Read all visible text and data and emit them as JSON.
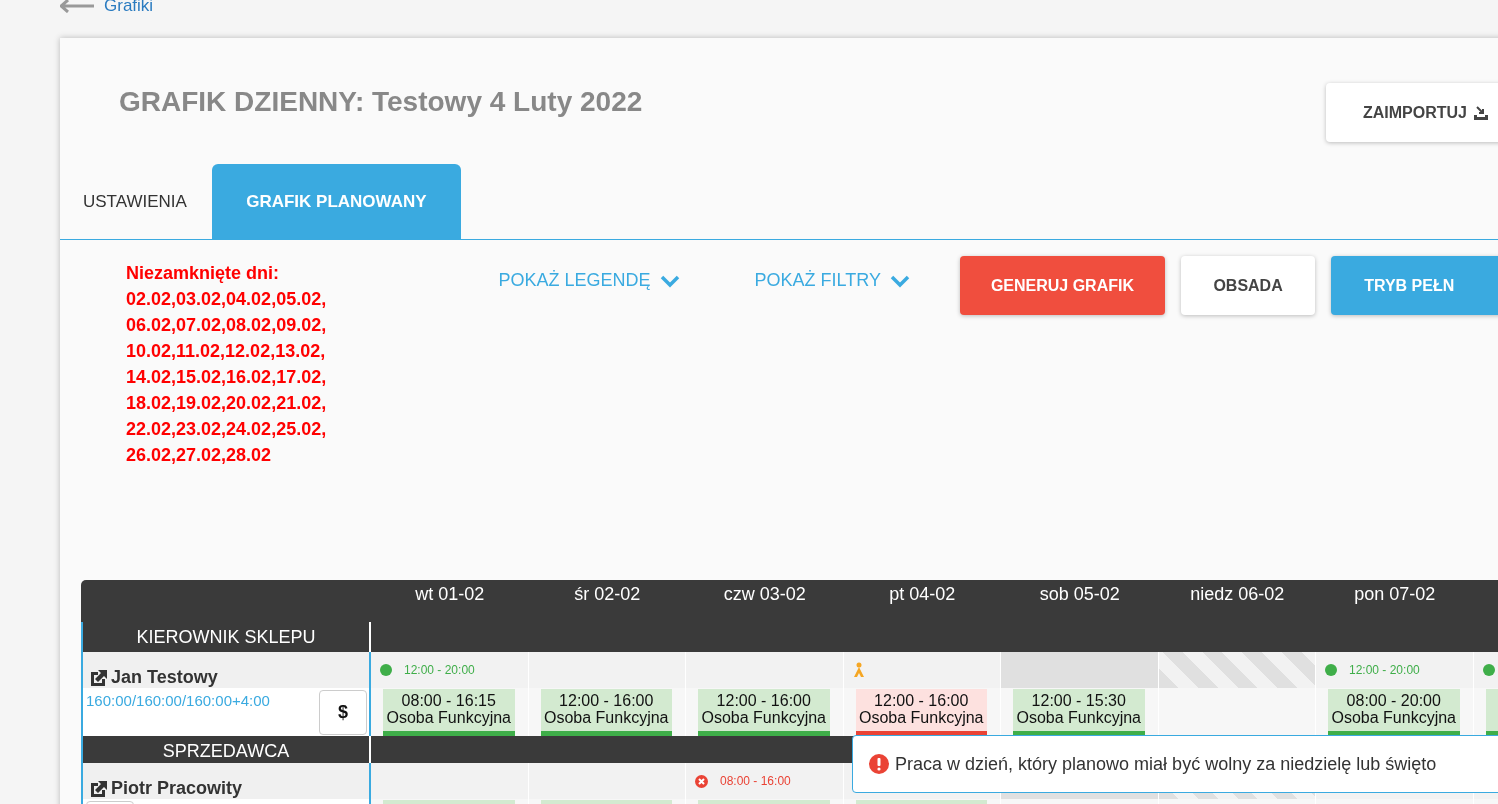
{
  "back_link": {
    "label": "Grafiki"
  },
  "title": "GRAFIK DZIENNY: Testowy 4 Luty 2022",
  "import_button": {
    "label": "ZAIMPORTUJ"
  },
  "tabs": [
    {
      "label": "USTAWIENIA",
      "selected": false
    },
    {
      "label": "GRAFIK PLANOWANY",
      "selected": true
    }
  ],
  "unclosed_days": {
    "label": "Niezamknięte dni:",
    "dates": "02.02,03.02,04.02,05.02,06.02,07.02,08.02,09.02,10.02,11.02,12.02,13.02,14.02,15.02,16.02,17.02,18.02,19.02,20.02,21.02,22.02,23.02,24.02,25.02,26.02,27.02,28.02"
  },
  "toggles": [
    {
      "label": "POKAŻ LEGENDĘ"
    },
    {
      "label": "POKAŻ FILTRY"
    }
  ],
  "actions": [
    {
      "label": "GENERUJ GRAFIK",
      "kind": "danger"
    },
    {
      "label": "OBSADA",
      "kind": "plain"
    },
    {
      "label": "TRYB PEŁN",
      "kind": "primary"
    }
  ],
  "days": [
    {
      "label": "wt 01-02",
      "kind": "workday"
    },
    {
      "label": "śr 02-02",
      "kind": "workday"
    },
    {
      "label": "czw 03-02",
      "kind": "workday"
    },
    {
      "label": "pt 04-02",
      "kind": "workday"
    },
    {
      "label": "sob 05-02",
      "kind": "saturday"
    },
    {
      "label": "niedz 06-02",
      "kind": "sunday"
    },
    {
      "label": "pon 07-02",
      "kind": "workday"
    },
    {
      "kind": "workday"
    }
  ],
  "groups": [
    {
      "title": "KIEROWNIK SKLEPU",
      "employees": [
        {
          "name": "Jan Testowy",
          "hours": "160:00/160:00/160:00+4:00",
          "pay_label": "$",
          "cells": [
            {
              "marker": {
                "kind": "dot",
                "time": "12:00 - 20:00"
              },
              "shift": {
                "time": "08:00 - 16:15",
                "role": "Osoba Funkcyjna",
                "error": false
              }
            },
            {
              "shift": {
                "time": "12:00 - 16:00",
                "role": "Osoba Funkcyjna",
                "error": false
              }
            },
            {
              "shift": {
                "time": "12:00 - 16:00",
                "role": "Osoba Funkcyjna",
                "error": false
              }
            },
            {
              "marker": {
                "kind": "figure"
              },
              "shift": {
                "time": "12:00 - 16:00",
                "role": "Osoba Funkcyjna",
                "error": true
              }
            },
            {
              "shift": {
                "time": "12:00 - 15:30",
                "role": "Osoba Funkcyjna",
                "error": false
              }
            },
            {},
            {
              "marker": {
                "kind": "dot",
                "time": "12:00 - 20:00"
              },
              "shift": {
                "time": "08:00 - 20:00",
                "role": "Osoba Funkcyjna",
                "error": false
              }
            },
            {
              "marker": {
                "kind": "dot"
              },
              "shift": {
                "error": false
              }
            }
          ]
        }
      ]
    },
    {
      "title": "SPRZEDAWCA",
      "employees": [
        {
          "name": "Piotr Pracowity",
          "cells": [
            {
              "shift": {
                "error": false
              }
            },
            {
              "shift": {
                "error": false
              }
            },
            {
              "marker": {
                "kind": "error",
                "time": "08:00 - 16:00"
              },
              "shift": {
                "error": false
              }
            },
            {
              "shift": {
                "error": false
              }
            },
            {},
            {},
            {},
            {}
          ]
        }
      ]
    }
  ],
  "tooltip": {
    "text": "Praca w dzień, który planowo miał być wolny za niedzielę lub święto"
  }
}
